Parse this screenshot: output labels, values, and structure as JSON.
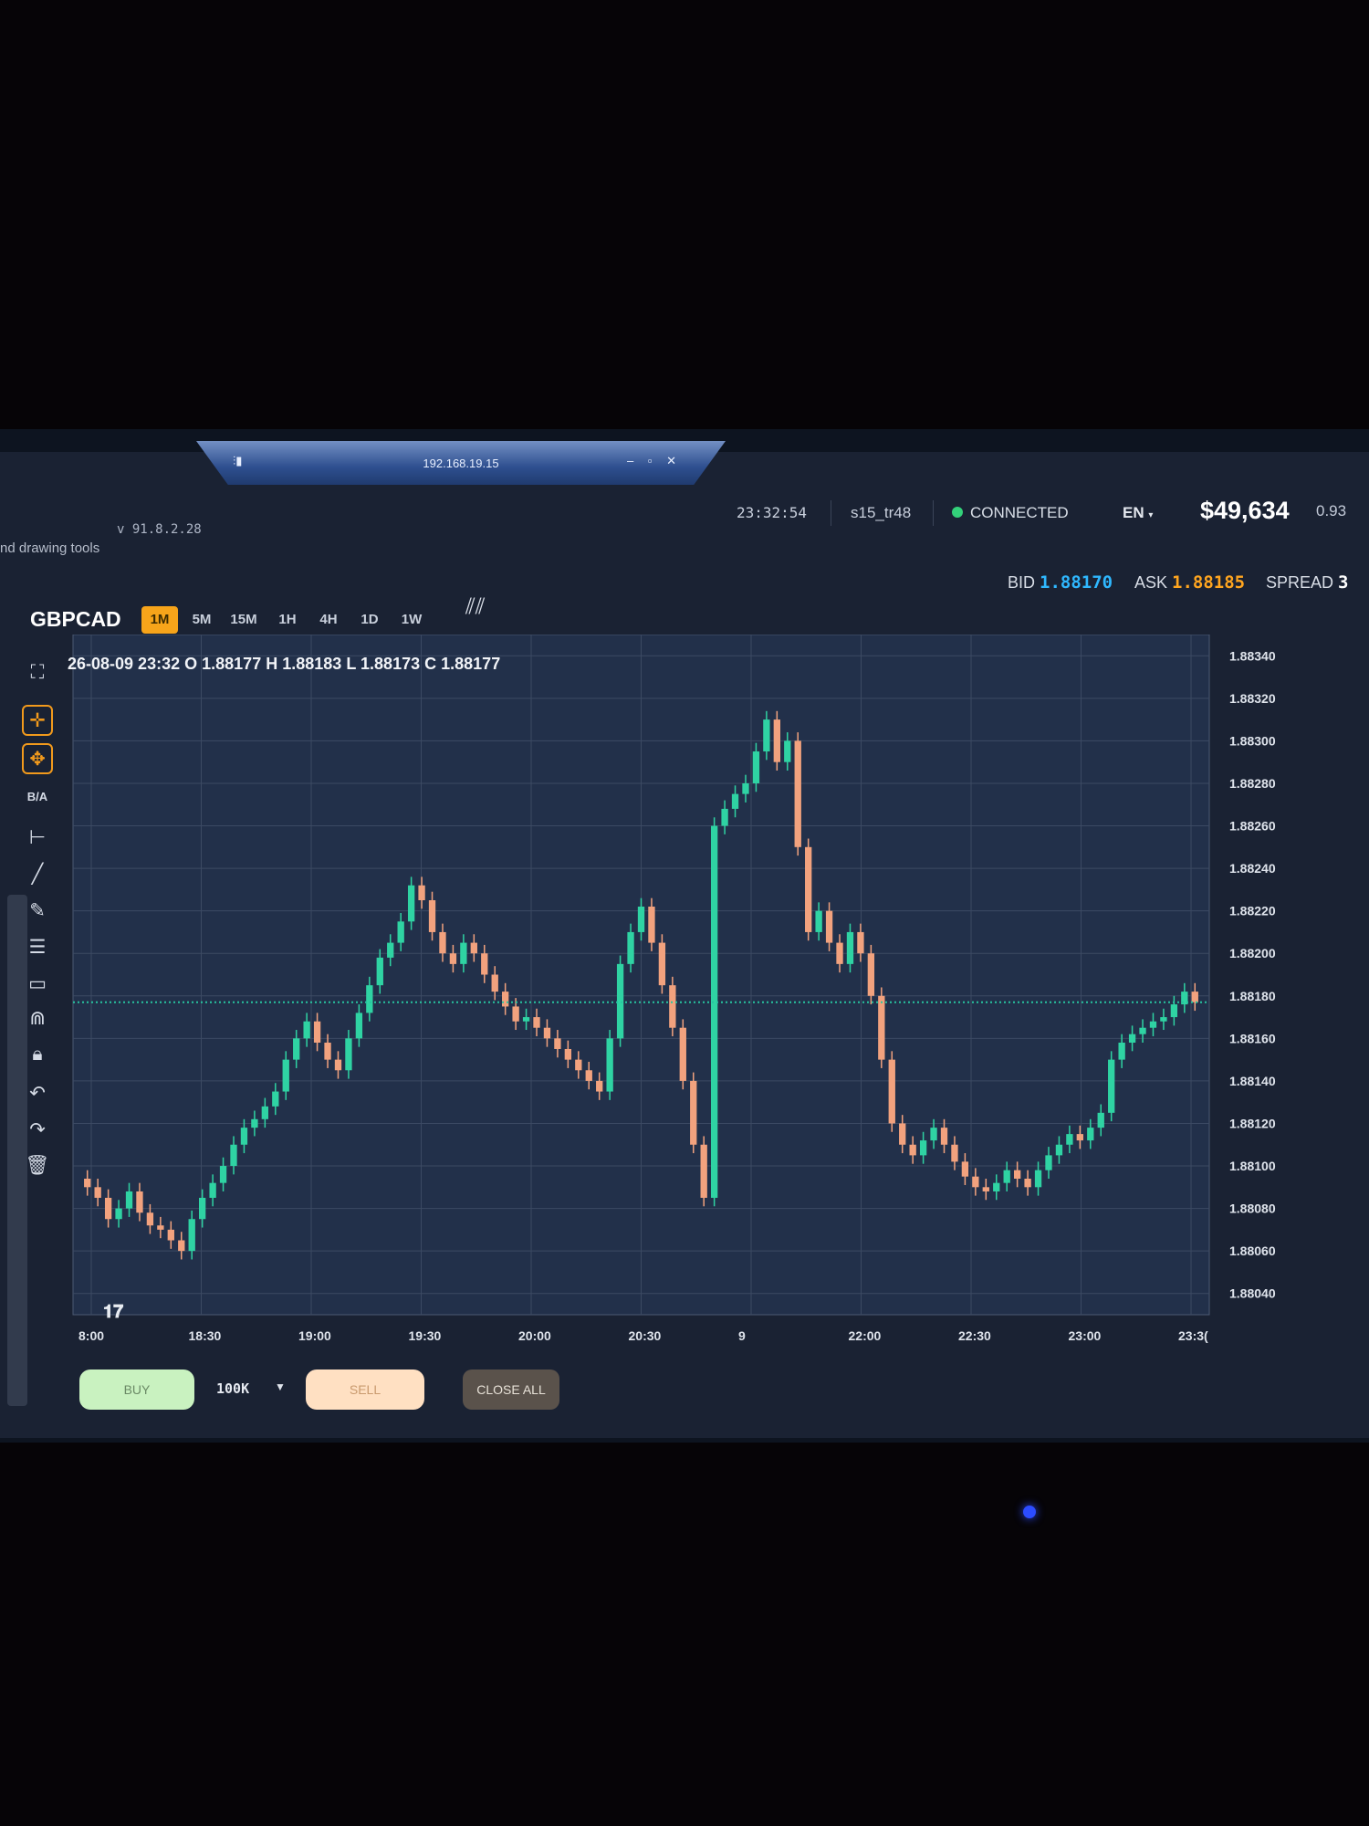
{
  "remote_bar": {
    "host": "192.168.19.15"
  },
  "header": {
    "version": "v 91.8.2.28",
    "subtitle": "nd drawing tools",
    "clock": "23:32:54",
    "user": "s15_tr48",
    "status": "CONNECTED",
    "language": "EN",
    "balance": "$49,634",
    "ratio": "0.93"
  },
  "quote": {
    "bid_label": "BID",
    "bid": "1.88170",
    "ask_label": "ASK",
    "ask": "1.88185",
    "spread_label": "SPREAD",
    "spread": "3"
  },
  "symbol": "GBPCAD",
  "timeframes": [
    "1M",
    "5M",
    "15M",
    "1H",
    "4H",
    "1D",
    "1W"
  ],
  "active_timeframe": "1M",
  "ohlc": {
    "date": "26-08-09 23:32",
    "o_label": "O",
    "o": "1.88177",
    "h_label": "H",
    "h": "1.88183",
    "l_label": "L",
    "l": "1.88173",
    "c_label": "C",
    "c": "1.88177"
  },
  "tools": {
    "ba_label": "B/A"
  },
  "colors": {
    "up": "#2fd3a3",
    "down": "#f2a27e",
    "active_tf": "#f7a41a",
    "bid": "#2fb8ff",
    "ask": "#ffa51f",
    "price_line": "#27c4a0"
  },
  "chart_data": {
    "type": "candlestick",
    "ylim": [
      1.8803,
      1.8835
    ],
    "y_ticks": [
      "1.88340",
      "1.88320",
      "1.88300",
      "1.88280",
      "1.88260",
      "1.88240",
      "1.88220",
      "1.88200",
      "1.88180",
      "1.88160",
      "1.88140",
      "1.88120",
      "1.88100",
      "1.88080",
      "1.88060",
      "1.88040"
    ],
    "x_ticks": [
      "8:00",
      "18:30",
      "19:00",
      "19:30",
      "20:00",
      "20:30",
      "9",
      "22:00",
      "22:30",
      "23:00",
      "23:3("
    ],
    "current_price": 1.88177,
    "close_series": [
      1.8809,
      1.88085,
      1.88075,
      1.8808,
      1.88088,
      1.88078,
      1.88072,
      1.8807,
      1.88065,
      1.8806,
      1.88075,
      1.88085,
      1.88092,
      1.881,
      1.8811,
      1.88118,
      1.88122,
      1.88128,
      1.88135,
      1.8815,
      1.8816,
      1.88168,
      1.88158,
      1.8815,
      1.88145,
      1.8816,
      1.88172,
      1.88185,
      1.88198,
      1.88205,
      1.88215,
      1.88232,
      1.88225,
      1.8821,
      1.882,
      1.88195,
      1.88205,
      1.882,
      1.8819,
      1.88182,
      1.88175,
      1.88168,
      1.8817,
      1.88165,
      1.8816,
      1.88155,
      1.8815,
      1.88145,
      1.8814,
      1.88135,
      1.8816,
      1.88195,
      1.8821,
      1.88222,
      1.88205,
      1.88185,
      1.88165,
      1.8814,
      1.8811,
      1.88085,
      1.8826,
      1.88268,
      1.88275,
      1.8828,
      1.88295,
      1.8831,
      1.8829,
      1.883,
      1.8825,
      1.8821,
      1.8822,
      1.88205,
      1.88195,
      1.8821,
      1.882,
      1.8818,
      1.8815,
      1.8812,
      1.8811,
      1.88105,
      1.88112,
      1.88118,
      1.8811,
      1.88102,
      1.88095,
      1.8809,
      1.88088,
      1.88092,
      1.88098,
      1.88094,
      1.8809,
      1.88098,
      1.88105,
      1.8811,
      1.88115,
      1.88112,
      1.88118,
      1.88125,
      1.8815,
      1.88158,
      1.88162,
      1.88165,
      1.88168,
      1.8817,
      1.88176,
      1.88182,
      1.88177
    ]
  },
  "order_panel": {
    "buy_label": "BUY",
    "qty": "100K",
    "sell_label": "SELL",
    "close_all_label": "CLOSE ALL"
  }
}
